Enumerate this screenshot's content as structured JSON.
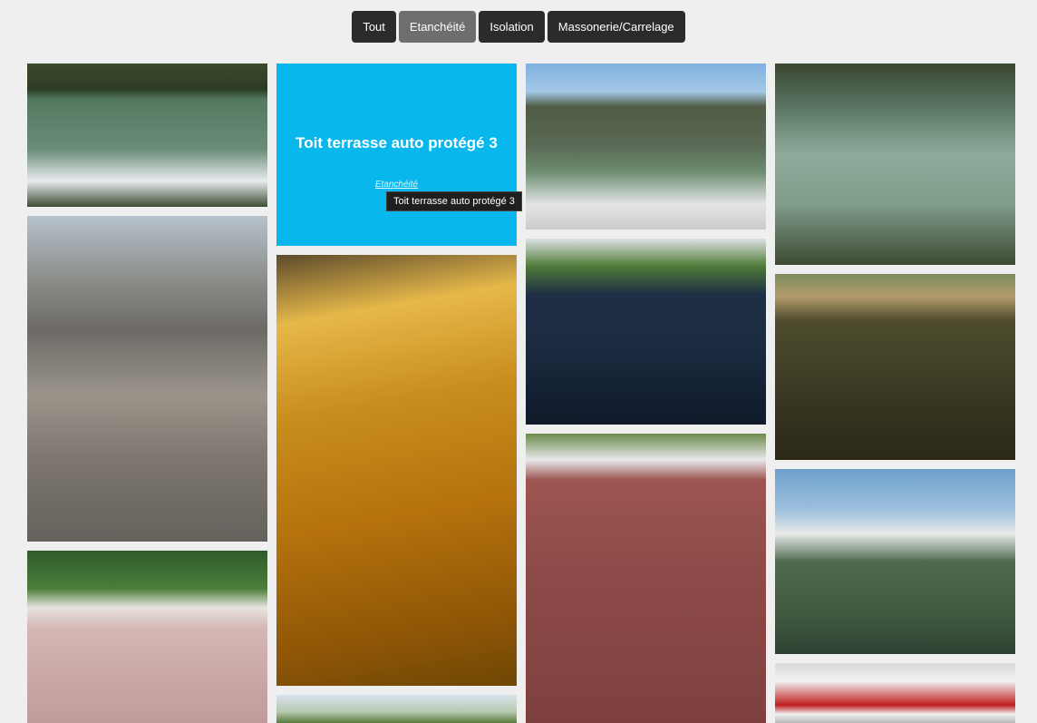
{
  "filters": [
    {
      "label": "Tout"
    },
    {
      "label": "Etanchéité"
    },
    {
      "label": "Isolation"
    },
    {
      "label": "Massonerie/Carrelage"
    }
  ],
  "active_filter": "Etanchéité",
  "gallery": {
    "hovered": {
      "title": "Toit terrasse auto protégé 3",
      "category": "Etanchéité",
      "tooltip": "Toit terrasse auto protégé 3"
    }
  },
  "colors": {
    "button_bg": "#2b2b2b",
    "button_active_bg": "#6e6e6e",
    "hover_overlay": "#08b8ec",
    "page_bg": "#efefef"
  }
}
